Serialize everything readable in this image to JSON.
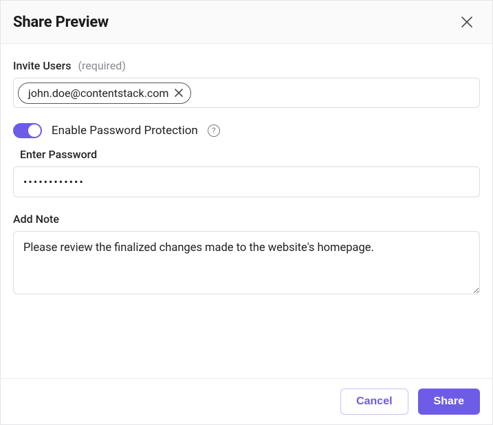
{
  "header": {
    "title": "Share Preview"
  },
  "invite": {
    "label": "Invite Users",
    "hint": "(required)",
    "chips": [
      {
        "email": "john.doe@contentstack.com"
      }
    ]
  },
  "password": {
    "toggle_label": "Enable Password Protection",
    "enabled": true,
    "enter_label": "Enter Password",
    "value": "••••••••••••"
  },
  "note": {
    "label": "Add Note",
    "value": "Please review the finalized changes made to the website's homepage."
  },
  "footer": {
    "cancel": "Cancel",
    "share": "Share"
  },
  "icons": {
    "help_glyph": "?"
  }
}
